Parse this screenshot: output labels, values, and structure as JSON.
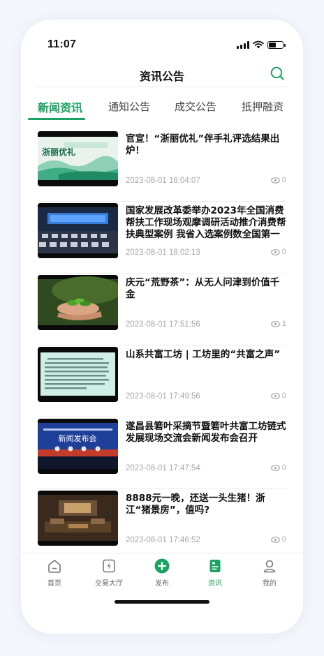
{
  "status": {
    "time": "11:07"
  },
  "header": {
    "title": "资讯公告"
  },
  "tabs": [
    {
      "label": "新闻资讯",
      "active": true
    },
    {
      "label": "通知公告",
      "active": false
    },
    {
      "label": "成交公告",
      "active": false
    },
    {
      "label": "抵押融资",
      "active": false
    }
  ],
  "articles": [
    {
      "title": "官宣！“浙丽优礼”伴手礼评选结果出炉！",
      "date": "2023-08-01 18:04:07",
      "views": "0",
      "thumb_text": "浙丽优礼"
    },
    {
      "title": "国家发展改革委举办2023年全国消费帮扶工作现场观摩调研活动推介消费帮扶典型案例 我省入选案例数全国第一",
      "date": "2023-08-01 18:02:13",
      "views": "0"
    },
    {
      "title": "庆元“荒野茶”：从无人问津到价值千金",
      "date": "2023-08-01 17:51:56",
      "views": "1"
    },
    {
      "title": "山系共富工坊 | 工坊里的“共富之声”",
      "date": "2023-08-01 17:49:56",
      "views": "0"
    },
    {
      "title": "遂昌县箬叶采摘节暨箬叶共富工坊链式发展现场交流会新闻发布会召开",
      "date": "2023-08-01 17:47:54",
      "views": "0",
      "thumb_text": "新闻发布会"
    },
    {
      "title": "8888元一晚，还送一头生猪！浙江“猪景房”，值吗?",
      "date": "2023-08-01 17:46:52",
      "views": "0"
    }
  ],
  "tabbar": [
    {
      "label": "首页",
      "icon": "home-icon"
    },
    {
      "label": "交易大厅",
      "icon": "lightning-icon"
    },
    {
      "label": "发布",
      "icon": "plus-icon"
    },
    {
      "label": "资讯",
      "icon": "news-icon",
      "active": true
    },
    {
      "label": "我的",
      "icon": "user-icon"
    }
  ],
  "colors": {
    "accent": "#1aa260",
    "text": "#111111",
    "muted": "#a8a8a8"
  }
}
